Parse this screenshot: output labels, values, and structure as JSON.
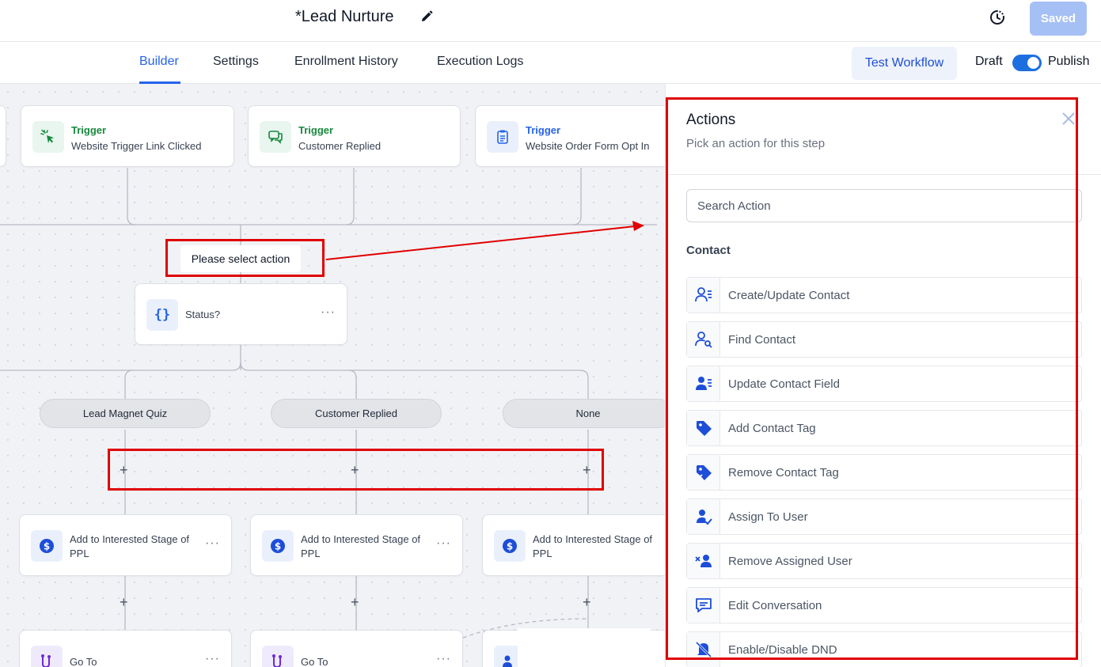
{
  "header": {
    "workflow_title": "*Lead Nurture",
    "saved_label": "Saved"
  },
  "tabs": [
    {
      "label": "Builder",
      "active": true
    },
    {
      "label": "Settings",
      "active": false
    },
    {
      "label": "Enrollment History",
      "active": false
    },
    {
      "label": "Execution Logs",
      "active": false
    }
  ],
  "controls": {
    "test_workflow_label": "Test Workflow",
    "draft_label": "Draft",
    "publish_label": "Publish",
    "publish_toggle_on": true
  },
  "canvas": {
    "triggers": [
      {
        "kicker": "Trigger",
        "label": "Website Trigger Link Clicked",
        "icon": "cursor-click-icon"
      },
      {
        "kicker": "Trigger",
        "label": "Customer Replied",
        "icon": "chat-icon"
      },
      {
        "kicker": "Trigger",
        "label": "Website Order Form Opt In",
        "icon": "clipboard-icon"
      }
    ],
    "select_action_label": "Please select action",
    "condition_node": {
      "label": "Status?",
      "icon": "braces-icon"
    },
    "branches": [
      "Lead Magnet Quiz",
      "Customer Replied",
      "None"
    ],
    "action_nodes": [
      {
        "label": "Add to Interested Stage of PPL",
        "icon": "dollar-icon"
      },
      {
        "label": "Add to Interested Stage of PPL",
        "icon": "dollar-icon"
      },
      {
        "label": "Add to Interested Stage of PPL",
        "icon": "dollar-icon"
      }
    ],
    "goto_nodes": [
      {
        "label": "Go To",
        "icon": "goto-icon"
      },
      {
        "label": "Go To",
        "icon": "goto-icon"
      }
    ]
  },
  "panel": {
    "title": "Actions",
    "subtitle": "Pick an action for this step",
    "search_placeholder": "Search Action",
    "section_label": "Contact",
    "actions": [
      {
        "label": "Create/Update Contact",
        "icon": "contact-list-icon"
      },
      {
        "label": "Find Contact",
        "icon": "find-contact-icon"
      },
      {
        "label": "Update Contact Field",
        "icon": "contact-field-icon"
      },
      {
        "label": "Add Contact Tag",
        "icon": "tag-icon"
      },
      {
        "label": "Remove Contact Tag",
        "icon": "remove-tag-icon"
      },
      {
        "label": "Assign To User",
        "icon": "assign-user-icon"
      },
      {
        "label": "Remove Assigned User",
        "icon": "remove-user-icon"
      },
      {
        "label": "Edit Conversation",
        "icon": "conversation-icon"
      },
      {
        "label": "Enable/Disable DND",
        "icon": "bell-off-icon"
      }
    ]
  },
  "colors": {
    "accent": "#2563eb",
    "trigger_green": "#16893d",
    "annotation_red": "#e00000",
    "saved_button": "#a5c0f4"
  }
}
